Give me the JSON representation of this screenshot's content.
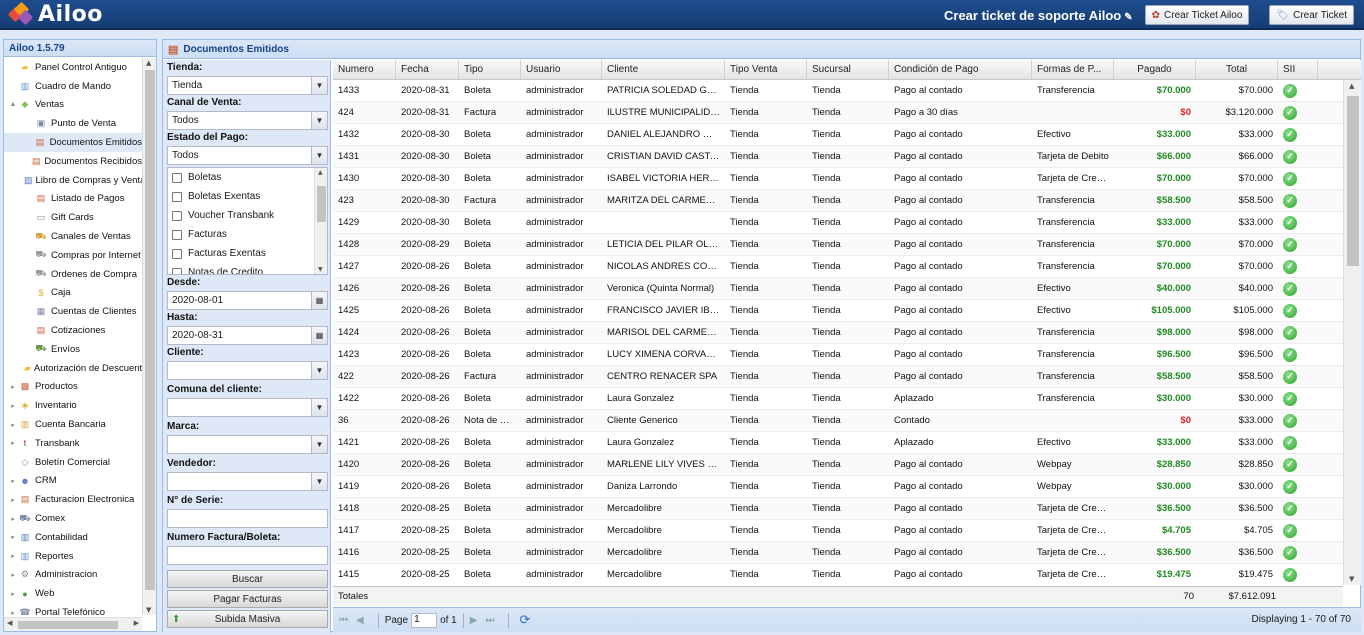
{
  "header": {
    "logo_text": "Ailoo",
    "support_title": "Crear ticket de soporte Ailoo",
    "crear_ticket_ailoo": "Crear Ticket Ailoo",
    "crear_ticket": "Crear Ticket"
  },
  "sidebar": {
    "title": "Ailoo 1.5.79",
    "items": [
      {
        "label": "Panel Control Antiguo",
        "icon": "folder-icon",
        "color": "#f0c040",
        "level": 1,
        "twisty": ""
      },
      {
        "label": "Cuadro de Mando",
        "icon": "chart-icon",
        "color": "#5b8fd6",
        "level": 1,
        "twisty": ""
      },
      {
        "label": "Ventas",
        "icon": "tag-icon",
        "color": "#8bbf5a",
        "level": 1,
        "twisty": "▲"
      },
      {
        "label": "Punto de Venta",
        "icon": "register-icon",
        "color": "#7d8aa6",
        "level": 2,
        "twisty": ""
      },
      {
        "label": "Documentos Emitidos",
        "icon": "document-icon",
        "color": "#c9643c",
        "level": 2,
        "twisty": "",
        "selected": true
      },
      {
        "label": "Documentos Recibidos",
        "icon": "document-icon",
        "color": "#c9643c",
        "level": 2,
        "twisty": ""
      },
      {
        "label": "Libro de Compras y Ventas",
        "icon": "book-icon",
        "color": "#4a78c2",
        "level": 2,
        "twisty": ""
      },
      {
        "label": "Listado de Pagos",
        "icon": "list-icon",
        "color": "#c9643c",
        "level": 2,
        "twisty": ""
      },
      {
        "label": "Gift Cards",
        "icon": "card-icon",
        "color": "#7d8aa6",
        "level": 2,
        "twisty": ""
      },
      {
        "label": "Canales de Ventas",
        "icon": "cart-icon",
        "color": "#d6a43c",
        "level": 2,
        "twisty": ""
      },
      {
        "label": "Compras por Internet",
        "icon": "cart-icon",
        "color": "#999999",
        "level": 2,
        "twisty": ""
      },
      {
        "label": "Ordenes de Compra",
        "icon": "cart-icon",
        "color": "#999999",
        "level": 2,
        "twisty": ""
      },
      {
        "label": "Caja",
        "icon": "cash-icon",
        "color": "#e0b030",
        "level": 2,
        "twisty": ""
      },
      {
        "label": "Cuentas de Clientes",
        "icon": "accounts-icon",
        "color": "#7d8aa6",
        "level": 2,
        "twisty": ""
      },
      {
        "label": "Cotizaciones",
        "icon": "document-icon",
        "color": "#c9643c",
        "level": 2,
        "twisty": ""
      },
      {
        "label": "Envíos",
        "icon": "truck-icon",
        "color": "#6a9a4a",
        "level": 2,
        "twisty": ""
      },
      {
        "label": "Autorización de Descuentos",
        "icon": "folder-icon",
        "color": "#f0c040",
        "level": 2,
        "twisty": ""
      },
      {
        "label": "Productos",
        "icon": "box-icon",
        "color": "#c9643c",
        "level": 1,
        "twisty": "▸"
      },
      {
        "label": "Inventario",
        "icon": "inventory-icon",
        "color": "#e0b030",
        "level": 1,
        "twisty": "▸"
      },
      {
        "label": "Cuenta Bancaria",
        "icon": "bank-icon",
        "color": "#d6a43c",
        "level": 1,
        "twisty": "▸"
      },
      {
        "label": "Transbank",
        "icon": "transbank-icon",
        "color": "#c02020",
        "level": 1,
        "twisty": "▸"
      },
      {
        "label": "Boletín Comercial",
        "icon": "bulletin-icon",
        "color": "#8a8a8a",
        "level": 1,
        "twisty": ""
      },
      {
        "label": "CRM",
        "icon": "users-icon",
        "color": "#4a78c2",
        "level": 1,
        "twisty": "▸"
      },
      {
        "label": "Facturacion Electronica",
        "icon": "invoice-icon",
        "color": "#c9643c",
        "level": 1,
        "twisty": "▸"
      },
      {
        "label": "Comex",
        "icon": "truck-icon",
        "color": "#7d8aa6",
        "level": 1,
        "twisty": "▸"
      },
      {
        "label": "Contabilidad",
        "icon": "ledger-icon",
        "color": "#4a78c2",
        "level": 1,
        "twisty": "▸"
      },
      {
        "label": "Reportes",
        "icon": "chart-icon",
        "color": "#5b8fd6",
        "level": 1,
        "twisty": "▸"
      },
      {
        "label": "Administracion",
        "icon": "gear-icon",
        "color": "#8a8a8a",
        "level": 1,
        "twisty": "▸"
      },
      {
        "label": "Web",
        "icon": "globe-icon",
        "color": "#4a9a4a",
        "level": 1,
        "twisty": "▸"
      },
      {
        "label": "Portal Telefónico",
        "icon": "phone-icon",
        "color": "#7d8aa6",
        "level": 1,
        "twisty": "▸"
      }
    ]
  },
  "main": {
    "title": "Documentos Emitidos",
    "filters": {
      "tienda_label": "Tienda:",
      "tienda_value": "Tienda",
      "canal_label": "Canal de Venta:",
      "canal_value": "Todos",
      "estado_label": "Estado del Pago:",
      "estado_value": "Todos",
      "doc_types": [
        "Boletas",
        "Boletas Exentas",
        "Voucher Transbank",
        "Facturas",
        "Facturas Exentas",
        "Notas de Credito"
      ],
      "desde_label": "Desde:",
      "desde_value": "2020-08-01",
      "hasta_label": "Hasta:",
      "hasta_value": "2020-08-31",
      "cliente_label": "Cliente:",
      "comuna_label": "Comuna del cliente:",
      "marca_label": "Marca:",
      "vendedor_label": "Vendedor:",
      "serie_label": "N° de Serie:",
      "numero_label": "Numero Factura/Boleta:",
      "buscar": "Buscar",
      "pagar": "Pagar Facturas",
      "subida": "Subida Masiva"
    },
    "grid": {
      "columns": [
        "Numero",
        "Fecha",
        "Tipo",
        "Usuario",
        "Cliente",
        "Tipo Venta",
        "Sucursal",
        "Condición de Pago",
        "Formas de P...",
        "Pagado",
        "Total",
        "SII"
      ],
      "rows": [
        [
          "1433",
          "2020-08-31",
          "Boleta",
          "administrador",
          "PATRICIA SOLEDAD GARCIA",
          "Tienda",
          "Tienda",
          "Pago al contado",
          "Transferencia",
          "$70.000",
          "$70.000"
        ],
        [
          "424",
          "2020-08-31",
          "Factura",
          "administrador",
          "ILUSTRE MUNICIPALIDAD DE",
          "Tienda",
          "Tienda",
          "Pago a 30 días",
          "",
          "$0",
          "$3.120.000"
        ],
        [
          "1432",
          "2020-08-30",
          "Boleta",
          "administrador",
          "DANIEL ALEJANDRO MIRANDA",
          "Tienda",
          "Tienda",
          "Pago al contado",
          "Efectivo",
          "$33.000",
          "$33.000"
        ],
        [
          "1431",
          "2020-08-30",
          "Boleta",
          "administrador",
          "CRISTIAN DAVID CASTAÑEDA",
          "Tienda",
          "Tienda",
          "Pago al contado",
          "Tarjeta de Debito",
          "$66.000",
          "$66.000"
        ],
        [
          "1430",
          "2020-08-30",
          "Boleta",
          "administrador",
          "ISABEL VICTORIA HERNANDEZ",
          "Tienda",
          "Tienda",
          "Pago al contado",
          "Tarjeta de Credito",
          "$70.000",
          "$70.000"
        ],
        [
          "423",
          "2020-08-30",
          "Factura",
          "administrador",
          "MARITZA DEL CARMEN ROJAS",
          "Tienda",
          "Tienda",
          "Pago al contado",
          "Transferencia",
          "$58.500",
          "$58.500"
        ],
        [
          "1429",
          "2020-08-30",
          "Boleta",
          "administrador",
          "",
          "Tienda",
          "Tienda",
          "Pago al contado",
          "Transferencia",
          "$33.000",
          "$33.000"
        ],
        [
          "1428",
          "2020-08-29",
          "Boleta",
          "administrador",
          "LETICIA DEL PILAR OLMOS",
          "Tienda",
          "Tienda",
          "Pago al contado",
          "Transferencia",
          "$70.000",
          "$70.000"
        ],
        [
          "1427",
          "2020-08-26",
          "Boleta",
          "administrador",
          "NICOLAS ANDRES CONTRERAS",
          "Tienda",
          "Tienda",
          "Pago al contado",
          "Transferencia",
          "$70.000",
          "$70.000"
        ],
        [
          "1426",
          "2020-08-26",
          "Boleta",
          "administrador",
          "Veronica (Quinta Normal)",
          "Tienda",
          "Tienda",
          "Pago al contado",
          "Efectivo",
          "$40.000",
          "$40.000"
        ],
        [
          "1425",
          "2020-08-26",
          "Boleta",
          "administrador",
          "FRANCISCO JAVIER IBARRA",
          "Tienda",
          "Tienda",
          "Pago al contado",
          "Efectivo",
          "$105.000",
          "$105.000"
        ],
        [
          "1424",
          "2020-08-26",
          "Boleta",
          "administrador",
          "MARISOL DEL CARMEN SOTO",
          "Tienda",
          "Tienda",
          "Pago al contado",
          "Transferencia",
          "$98.000",
          "$98.000"
        ],
        [
          "1423",
          "2020-08-26",
          "Boleta",
          "administrador",
          "LUCY XIMENA CORVALAN",
          "Tienda",
          "Tienda",
          "Pago al contado",
          "Transferencia",
          "$96.500",
          "$96.500"
        ],
        [
          "422",
          "2020-08-26",
          "Factura",
          "administrador",
          "CENTRO RENACER SPA",
          "Tienda",
          "Tienda",
          "Pago al contado",
          "Transferencia",
          "$58.500",
          "$58.500"
        ],
        [
          "1422",
          "2020-08-26",
          "Boleta",
          "administrador",
          "Laura Gonzalez",
          "Tienda",
          "Tienda",
          "Aplazado",
          "Transferencia",
          "$30.000",
          "$30.000"
        ],
        [
          "36",
          "2020-08-26",
          "Nota de Credito",
          "administrador",
          "Cliente Generico",
          "Tienda",
          "Tienda",
          "Contado",
          "",
          "$0",
          "$33.000"
        ],
        [
          "1421",
          "2020-08-26",
          "Boleta",
          "administrador",
          "Laura Gonzalez",
          "Tienda",
          "Tienda",
          "Aplazado",
          "Efectivo",
          "$33.000",
          "$33.000"
        ],
        [
          "1420",
          "2020-08-26",
          "Boleta",
          "administrador",
          "MARLENE LILY VIVES CAMPOS",
          "Tienda",
          "Tienda",
          "Pago al contado",
          "Webpay",
          "$28.850",
          "$28.850"
        ],
        [
          "1419",
          "2020-08-26",
          "Boleta",
          "administrador",
          "Daniza Larrondo",
          "Tienda",
          "Tienda",
          "Pago al contado",
          "Webpay",
          "$30.000",
          "$30.000"
        ],
        [
          "1418",
          "2020-08-25",
          "Boleta",
          "administrador",
          "Mercadolibre",
          "Tienda",
          "Tienda",
          "Pago al contado",
          "Tarjeta de Credito",
          "$36.500",
          "$36.500"
        ],
        [
          "1417",
          "2020-08-25",
          "Boleta",
          "administrador",
          "Mercadolibre",
          "Tienda",
          "Tienda",
          "Pago al contado",
          "Tarjeta de Credito",
          "$4.705",
          "$4.705"
        ],
        [
          "1416",
          "2020-08-25",
          "Boleta",
          "administrador",
          "Mercadolibre",
          "Tienda",
          "Tienda",
          "Pago al contado",
          "Tarjeta de Credito",
          "$36.500",
          "$36.500"
        ],
        [
          "1415",
          "2020-08-25",
          "Boleta",
          "administrador",
          "Mercadolibre",
          "Tienda",
          "Tienda",
          "Pago al contado",
          "Tarjeta de Credito",
          "$19.475",
          "$19.475"
        ]
      ],
      "totals_label": "Totales",
      "totals_count": "70",
      "totals_amount": "$7.612.091"
    },
    "pager": {
      "page_label": "Page",
      "page_value": "1",
      "of_label": "of 1",
      "display": "Displaying 1 - 70 of 70"
    }
  }
}
